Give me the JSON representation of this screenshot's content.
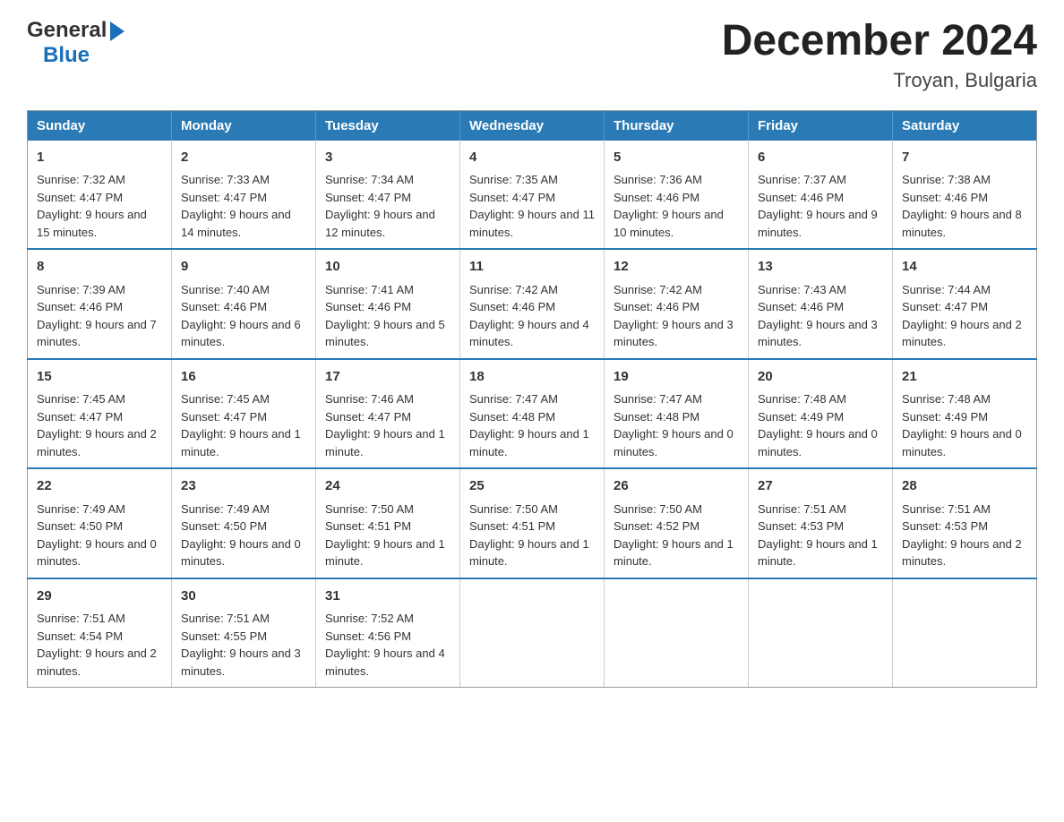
{
  "header": {
    "logo_general": "General",
    "logo_blue": "Blue",
    "month_title": "December 2024",
    "location": "Troyan, Bulgaria"
  },
  "days_of_week": [
    "Sunday",
    "Monday",
    "Tuesday",
    "Wednesday",
    "Thursday",
    "Friday",
    "Saturday"
  ],
  "weeks": [
    [
      {
        "day": "1",
        "sunrise": "Sunrise: 7:32 AM",
        "sunset": "Sunset: 4:47 PM",
        "daylight": "Daylight: 9 hours and 15 minutes."
      },
      {
        "day": "2",
        "sunrise": "Sunrise: 7:33 AM",
        "sunset": "Sunset: 4:47 PM",
        "daylight": "Daylight: 9 hours and 14 minutes."
      },
      {
        "day": "3",
        "sunrise": "Sunrise: 7:34 AM",
        "sunset": "Sunset: 4:47 PM",
        "daylight": "Daylight: 9 hours and 12 minutes."
      },
      {
        "day": "4",
        "sunrise": "Sunrise: 7:35 AM",
        "sunset": "Sunset: 4:47 PM",
        "daylight": "Daylight: 9 hours and 11 minutes."
      },
      {
        "day": "5",
        "sunrise": "Sunrise: 7:36 AM",
        "sunset": "Sunset: 4:46 PM",
        "daylight": "Daylight: 9 hours and 10 minutes."
      },
      {
        "day": "6",
        "sunrise": "Sunrise: 7:37 AM",
        "sunset": "Sunset: 4:46 PM",
        "daylight": "Daylight: 9 hours and 9 minutes."
      },
      {
        "day": "7",
        "sunrise": "Sunrise: 7:38 AM",
        "sunset": "Sunset: 4:46 PM",
        "daylight": "Daylight: 9 hours and 8 minutes."
      }
    ],
    [
      {
        "day": "8",
        "sunrise": "Sunrise: 7:39 AM",
        "sunset": "Sunset: 4:46 PM",
        "daylight": "Daylight: 9 hours and 7 minutes."
      },
      {
        "day": "9",
        "sunrise": "Sunrise: 7:40 AM",
        "sunset": "Sunset: 4:46 PM",
        "daylight": "Daylight: 9 hours and 6 minutes."
      },
      {
        "day": "10",
        "sunrise": "Sunrise: 7:41 AM",
        "sunset": "Sunset: 4:46 PM",
        "daylight": "Daylight: 9 hours and 5 minutes."
      },
      {
        "day": "11",
        "sunrise": "Sunrise: 7:42 AM",
        "sunset": "Sunset: 4:46 PM",
        "daylight": "Daylight: 9 hours and 4 minutes."
      },
      {
        "day": "12",
        "sunrise": "Sunrise: 7:42 AM",
        "sunset": "Sunset: 4:46 PM",
        "daylight": "Daylight: 9 hours and 3 minutes."
      },
      {
        "day": "13",
        "sunrise": "Sunrise: 7:43 AM",
        "sunset": "Sunset: 4:46 PM",
        "daylight": "Daylight: 9 hours and 3 minutes."
      },
      {
        "day": "14",
        "sunrise": "Sunrise: 7:44 AM",
        "sunset": "Sunset: 4:47 PM",
        "daylight": "Daylight: 9 hours and 2 minutes."
      }
    ],
    [
      {
        "day": "15",
        "sunrise": "Sunrise: 7:45 AM",
        "sunset": "Sunset: 4:47 PM",
        "daylight": "Daylight: 9 hours and 2 minutes."
      },
      {
        "day": "16",
        "sunrise": "Sunrise: 7:45 AM",
        "sunset": "Sunset: 4:47 PM",
        "daylight": "Daylight: 9 hours and 1 minute."
      },
      {
        "day": "17",
        "sunrise": "Sunrise: 7:46 AM",
        "sunset": "Sunset: 4:47 PM",
        "daylight": "Daylight: 9 hours and 1 minute."
      },
      {
        "day": "18",
        "sunrise": "Sunrise: 7:47 AM",
        "sunset": "Sunset: 4:48 PM",
        "daylight": "Daylight: 9 hours and 1 minute."
      },
      {
        "day": "19",
        "sunrise": "Sunrise: 7:47 AM",
        "sunset": "Sunset: 4:48 PM",
        "daylight": "Daylight: 9 hours and 0 minutes."
      },
      {
        "day": "20",
        "sunrise": "Sunrise: 7:48 AM",
        "sunset": "Sunset: 4:49 PM",
        "daylight": "Daylight: 9 hours and 0 minutes."
      },
      {
        "day": "21",
        "sunrise": "Sunrise: 7:48 AM",
        "sunset": "Sunset: 4:49 PM",
        "daylight": "Daylight: 9 hours and 0 minutes."
      }
    ],
    [
      {
        "day": "22",
        "sunrise": "Sunrise: 7:49 AM",
        "sunset": "Sunset: 4:50 PM",
        "daylight": "Daylight: 9 hours and 0 minutes."
      },
      {
        "day": "23",
        "sunrise": "Sunrise: 7:49 AM",
        "sunset": "Sunset: 4:50 PM",
        "daylight": "Daylight: 9 hours and 0 minutes."
      },
      {
        "day": "24",
        "sunrise": "Sunrise: 7:50 AM",
        "sunset": "Sunset: 4:51 PM",
        "daylight": "Daylight: 9 hours and 1 minute."
      },
      {
        "day": "25",
        "sunrise": "Sunrise: 7:50 AM",
        "sunset": "Sunset: 4:51 PM",
        "daylight": "Daylight: 9 hours and 1 minute."
      },
      {
        "day": "26",
        "sunrise": "Sunrise: 7:50 AM",
        "sunset": "Sunset: 4:52 PM",
        "daylight": "Daylight: 9 hours and 1 minute."
      },
      {
        "day": "27",
        "sunrise": "Sunrise: 7:51 AM",
        "sunset": "Sunset: 4:53 PM",
        "daylight": "Daylight: 9 hours and 1 minute."
      },
      {
        "day": "28",
        "sunrise": "Sunrise: 7:51 AM",
        "sunset": "Sunset: 4:53 PM",
        "daylight": "Daylight: 9 hours and 2 minutes."
      }
    ],
    [
      {
        "day": "29",
        "sunrise": "Sunrise: 7:51 AM",
        "sunset": "Sunset: 4:54 PM",
        "daylight": "Daylight: 9 hours and 2 minutes."
      },
      {
        "day": "30",
        "sunrise": "Sunrise: 7:51 AM",
        "sunset": "Sunset: 4:55 PM",
        "daylight": "Daylight: 9 hours and 3 minutes."
      },
      {
        "day": "31",
        "sunrise": "Sunrise: 7:52 AM",
        "sunset": "Sunset: 4:56 PM",
        "daylight": "Daylight: 9 hours and 4 minutes."
      },
      null,
      null,
      null,
      null
    ]
  ]
}
